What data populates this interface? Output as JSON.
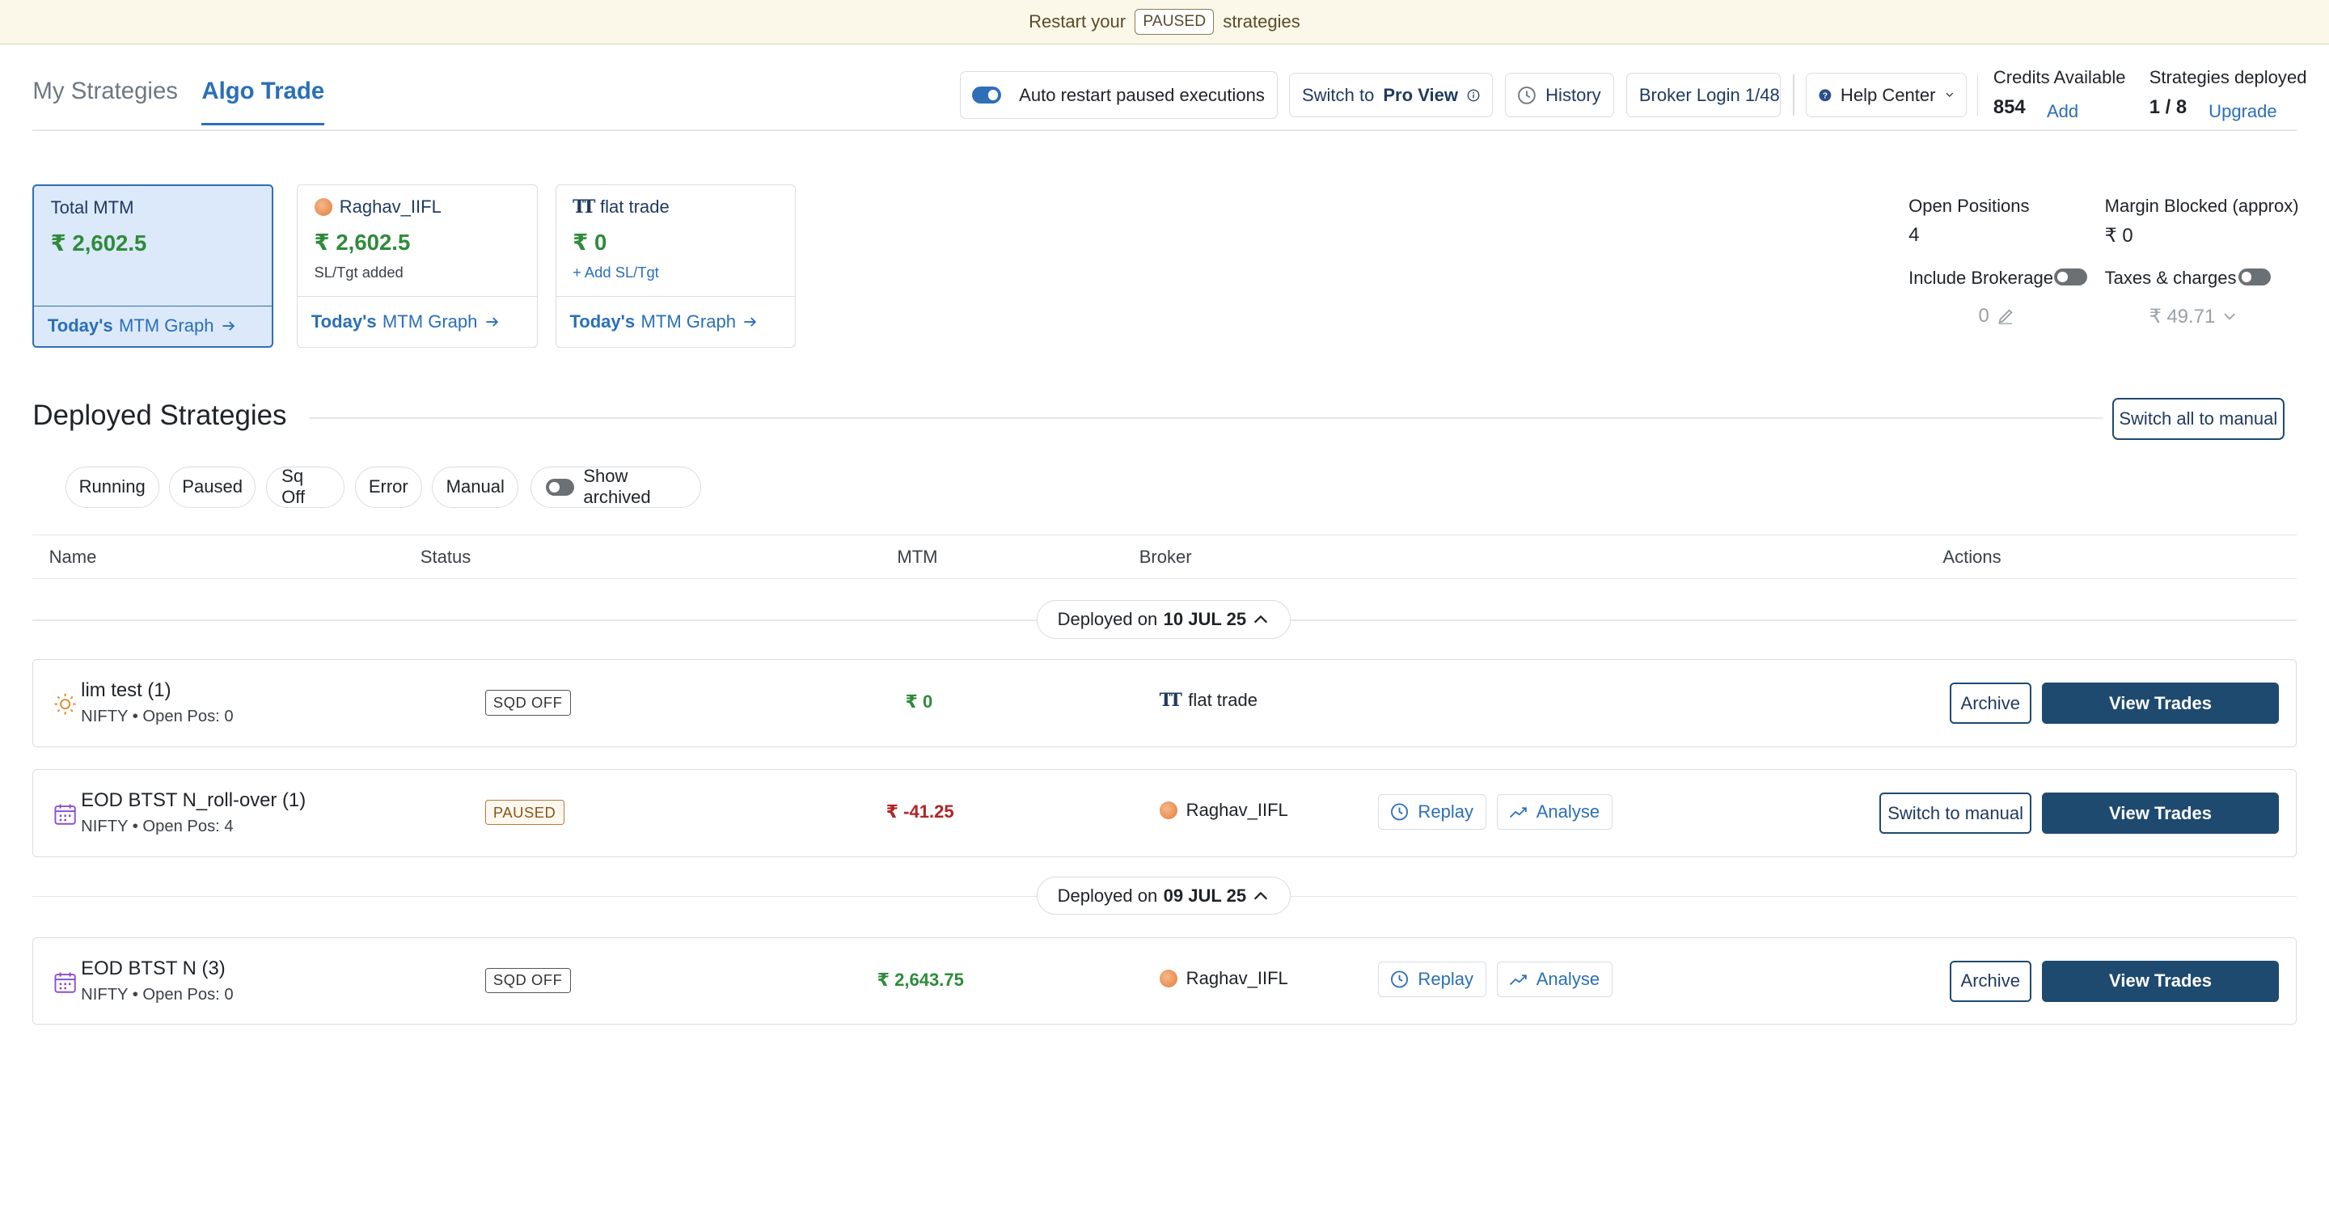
{
  "banner": {
    "prefix": "Restart your",
    "badge": "PAUSED",
    "suffix": "strategies"
  },
  "tabs": [
    {
      "label": "My Strategies"
    },
    {
      "label": "Algo Trade"
    }
  ],
  "toolbar": {
    "auto_restart": "Auto restart paused executions",
    "switch_to": "Switch to",
    "pro_view": "Pro View",
    "history": "History",
    "broker_login": "Broker Login 1/48",
    "help_center": "Help Center",
    "credits_label": "Credits Available",
    "credits_value": "854",
    "credits_add": "Add",
    "deployed_label": "Strategies deployed",
    "deployed_value": "1 / 8",
    "upgrade": "Upgrade"
  },
  "cards": [
    {
      "head": "Total MTM",
      "amount": "₹ 2,602.5",
      "sub": "",
      "foot_bold": "Today's",
      "foot": "MTM Graph"
    },
    {
      "head": "Raghav_IIFL",
      "amount": "₹ 2,602.5",
      "sub": "SL/Tgt added",
      "foot_bold": "Today's",
      "foot": "MTM Graph"
    },
    {
      "head": "flat trade",
      "amount": "₹ 0",
      "sub": "+ Add SL/Tgt",
      "foot_bold": "Today's",
      "foot": "MTM Graph"
    }
  ],
  "summary": {
    "open_positions_label": "Open Positions",
    "open_positions_value": "4",
    "margin_label": "Margin Blocked (approx)",
    "margin_value": "₹ 0",
    "brokerage_label": "Include Brokerage",
    "brokerage_value": "0",
    "taxes_label": "Taxes & charges",
    "taxes_value": "₹ 49.71"
  },
  "deployed": {
    "title": "Deployed Strategies",
    "switch_all": "Switch all to manual",
    "filters": [
      "Running",
      "Paused",
      "Sq Off",
      "Error",
      "Manual"
    ],
    "show_archived": "Show archived",
    "columns": [
      "Name",
      "Status",
      "MTM",
      "Broker",
      "Actions"
    ],
    "groups": [
      {
        "prefix": "Deployed on",
        "date": "10 JUL 25"
      },
      {
        "prefix": "Deployed on",
        "date": "09 JUL 25"
      }
    ],
    "rows": [
      {
        "name": "lim test (1)",
        "meta": "NIFTY  •  Open Pos: 0",
        "status": "SQD OFF",
        "mtm": "₹ 0",
        "broker": "flat trade",
        "secondary": "Archive",
        "primary": "View Trades"
      },
      {
        "name": "EOD BTST N_roll-over (1)",
        "meta": "NIFTY  •  Open Pos: 4",
        "status": "PAUSED",
        "mtm": "₹ -41.25",
        "broker": "Raghav_IIFL",
        "replay": "Replay",
        "analyse": "Analyse",
        "secondary": "Switch to manual",
        "primary": "View Trades"
      },
      {
        "name": "EOD BTST N (3)",
        "meta": "NIFTY  •  Open Pos: 0",
        "status": "SQD OFF",
        "mtm": "₹ 2,643.75",
        "broker": "Raghav_IIFL",
        "replay": "Replay",
        "analyse": "Analyse",
        "secondary": "Archive",
        "primary": "View Trades"
      }
    ]
  },
  "colors": {
    "accent": "#2a6fb8",
    "navy": "#1f4a6f",
    "positive": "#2e8b3a",
    "negative": "#b22424",
    "banner_bg": "#fbf8e9"
  }
}
